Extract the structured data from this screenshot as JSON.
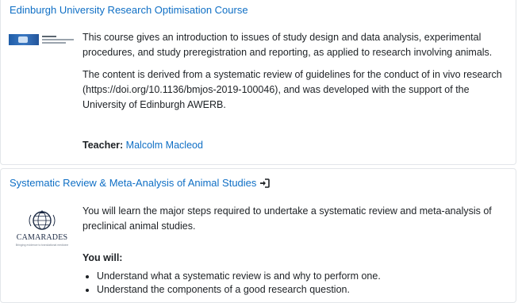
{
  "courses": [
    {
      "title": "Edinburgh University Research Optimisation Course",
      "summary": [
        "This course gives an introduction to issues of study design and data analysis, experimental procedures, and study preregistration and reporting, as applied to research involving animals.",
        "The content is derived from a systematic review of guidelines for the conduct of in vivo research (https://doi.org/10.1136/bmjos-2019-100046), and was developed with the support  of the University of Edinburgh AWERB."
      ],
      "teacher_label": "Teacher:",
      "teacher_name": "Malcolm Macleod",
      "logo_text": "EURIS"
    },
    {
      "title": "Systematic Review & Meta-Analysis of Animal Studies",
      "summary": [
        "You will learn the major steps required to undertake a systematic review and meta-analysis of preclinical animal studies."
      ],
      "you_will_label": "You will:",
      "bullets": [
        "Understand what a systematic review is and why to perform one.",
        "Understand the components of a good research question."
      ],
      "logo_text": "CAMARADES",
      "logo_tagline": "Bringing evidence to translational medicine"
    }
  ],
  "colors": {
    "link": "#0f6fc5",
    "text": "#1d2125",
    "border": "#e3e6ea"
  },
  "icons": {
    "guest_access": "enter-icon"
  }
}
